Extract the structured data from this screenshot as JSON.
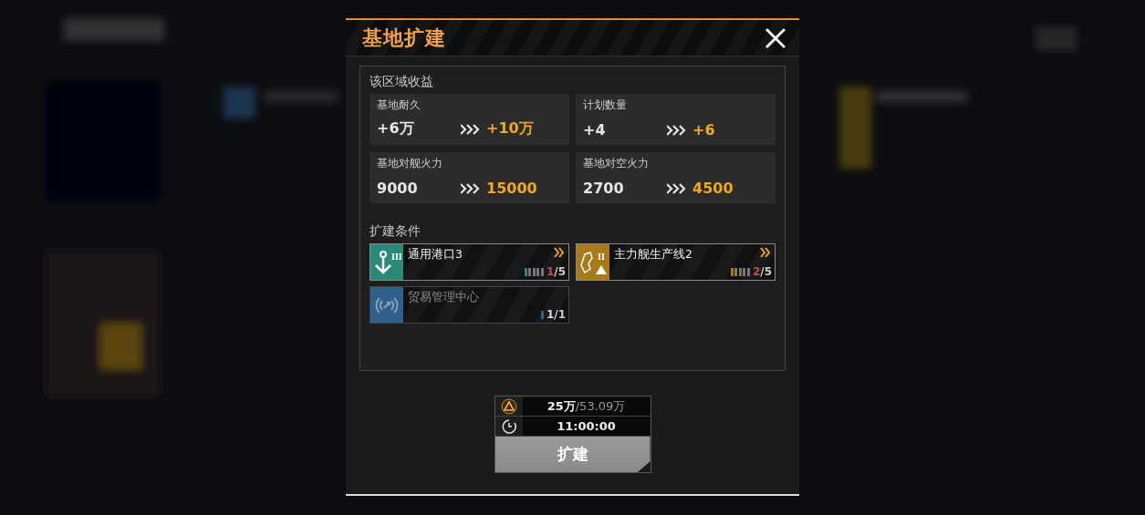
{
  "dialog": {
    "title": "基地扩建"
  },
  "benefits": {
    "heading": "该区域收益",
    "stats": [
      {
        "label": "基地耐久",
        "current": "+6万",
        "next": "+10万"
      },
      {
        "label": "计划数量",
        "current": "+4",
        "next": "+6"
      },
      {
        "label": "基地对舰火力",
        "current": "9000",
        "next": "15000"
      },
      {
        "label": "基地对空火力",
        "current": "2700",
        "next": "4500"
      }
    ]
  },
  "conditions": {
    "heading": "扩建条件",
    "items": [
      {
        "kind": "anchor",
        "tier": "III",
        "name": "通用港口3",
        "color": "#2a8a7a",
        "disabled": false,
        "met": false,
        "segments": [
          {
            "on": true
          },
          {
            "on": false
          },
          {
            "on": false
          },
          {
            "on": false
          },
          {
            "on": false
          }
        ],
        "current": "1",
        "total": "/5"
      },
      {
        "kind": "gear",
        "tier": "II",
        "name": "主力舰生产线2",
        "color": "#a77a1c",
        "disabled": false,
        "met": false,
        "segments": [
          {
            "on": true
          },
          {
            "on": true
          },
          {
            "on": false
          },
          {
            "on": false
          },
          {
            "on": false
          }
        ],
        "current": "2",
        "total": "/5"
      },
      {
        "kind": "signal",
        "name": "贸易管理中心",
        "color": "#2f5f8a",
        "disabled": true,
        "met": true,
        "segments": [
          {
            "on": true
          }
        ],
        "current": "1",
        "total": "/1"
      }
    ]
  },
  "cost": {
    "amount": "25万",
    "available": "/53.09万",
    "time": "11:00:00"
  },
  "button": {
    "label": "扩建"
  }
}
